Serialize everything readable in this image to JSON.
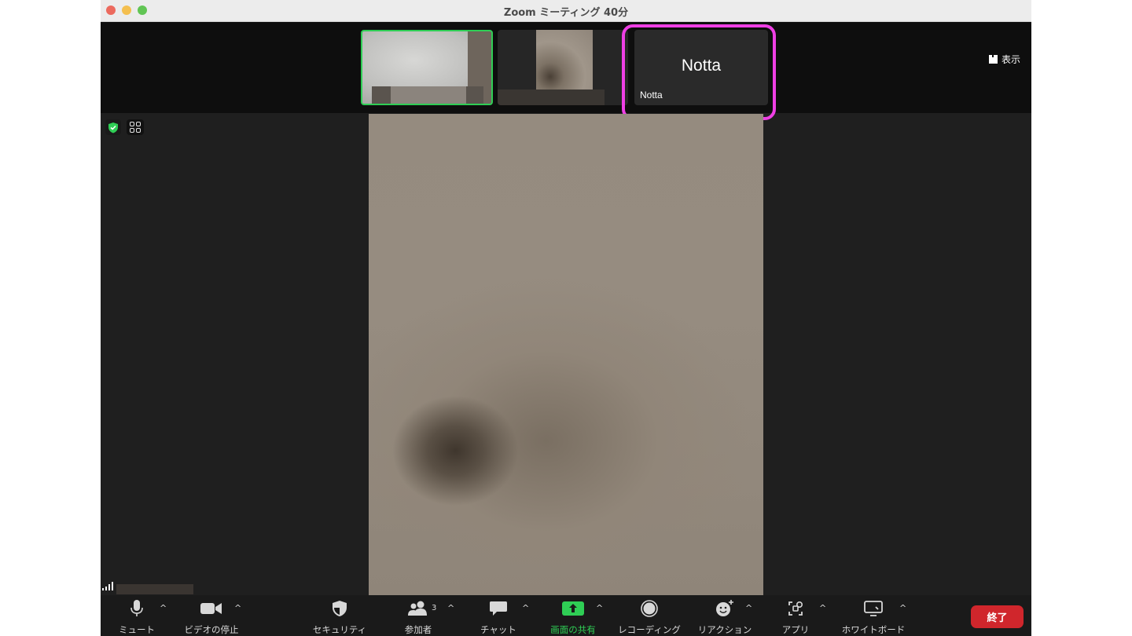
{
  "window": {
    "title": "Zoom ミーティング   40分"
  },
  "strip": {
    "tiles": [
      {
        "name": ""
      },
      {
        "name": ""
      },
      {
        "display_name": "Notta",
        "label": "Notta"
      }
    ],
    "view_button": "表示",
    "highlight_color": "#ef3fe5"
  },
  "toolbar": {
    "mute": "ミュート",
    "stop_video": "ビデオの停止",
    "security": "セキュリティ",
    "participants": "参加者",
    "participants_count": "3",
    "chat": "チャット",
    "share_screen": "画面の共有",
    "recording": "レコーディング",
    "reactions": "リアクション",
    "apps": "アプリ",
    "whiteboard": "ホワイトボード",
    "end": "終了"
  },
  "colors": {
    "active_speaker": "#2fce55",
    "end_button": "#d0262c",
    "share_icon": "#2fce55"
  }
}
